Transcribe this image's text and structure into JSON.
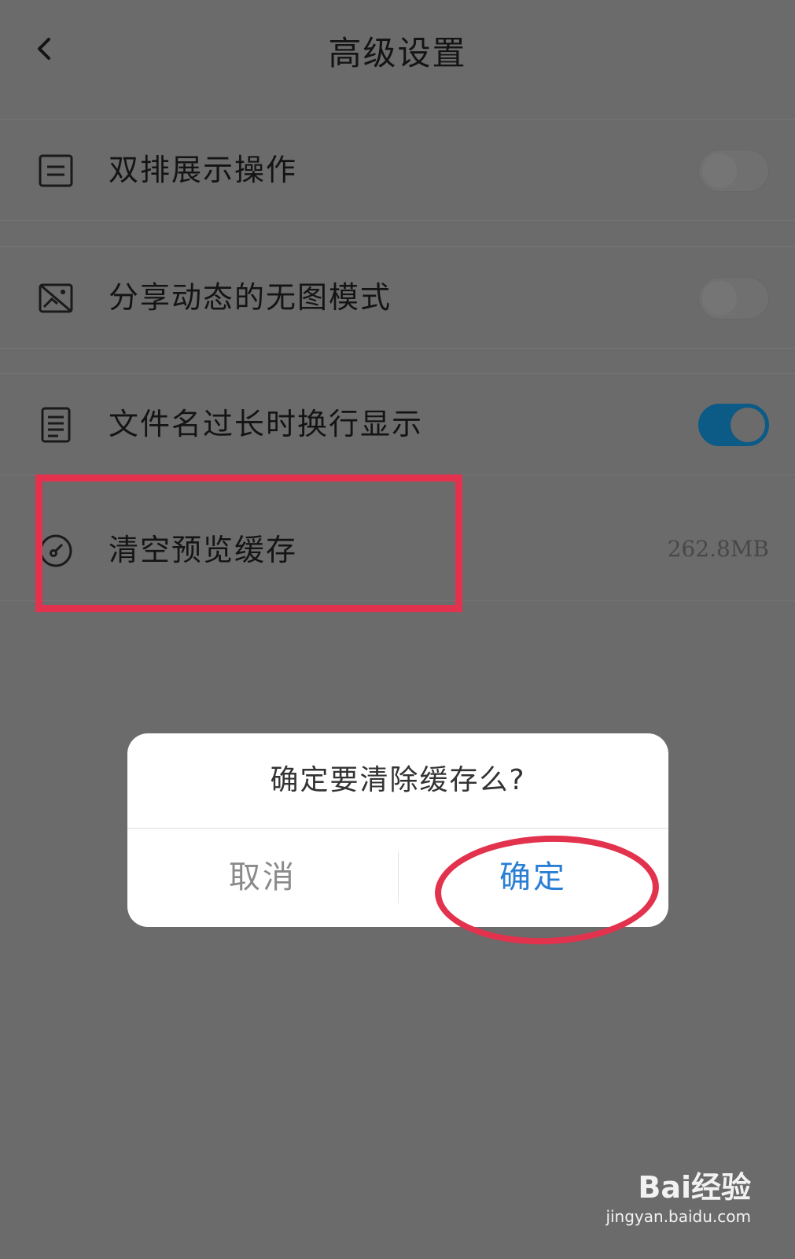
{
  "header": {
    "title": "高级设置",
    "back_icon": "chevron-left-icon"
  },
  "settings": [
    {
      "icon": "list-box-icon",
      "label": "双排展示操作",
      "control": "toggle",
      "on": false
    },
    {
      "icon": "no-image-icon",
      "label": "分享动态的无图模式",
      "control": "toggle",
      "on": false
    },
    {
      "icon": "document-icon",
      "label": "文件名过长时换行显示",
      "control": "toggle",
      "on": true
    },
    {
      "icon": "gauge-icon",
      "label": "清空预览缓存",
      "control": "value",
      "value": "262.8MB"
    }
  ],
  "dialog": {
    "message": "确定要清除缓存么?",
    "cancel_label": "取消",
    "confirm_label": "确定"
  },
  "colors": {
    "overlay_bg": "#6b6b6b",
    "toggle_on": "#0c5a86",
    "confirm_text": "#2a7fd4",
    "annotation_red": "#e2324e"
  },
  "watermark": {
    "logo": "Bai经验",
    "url": "jingyan.baidu.com"
  }
}
